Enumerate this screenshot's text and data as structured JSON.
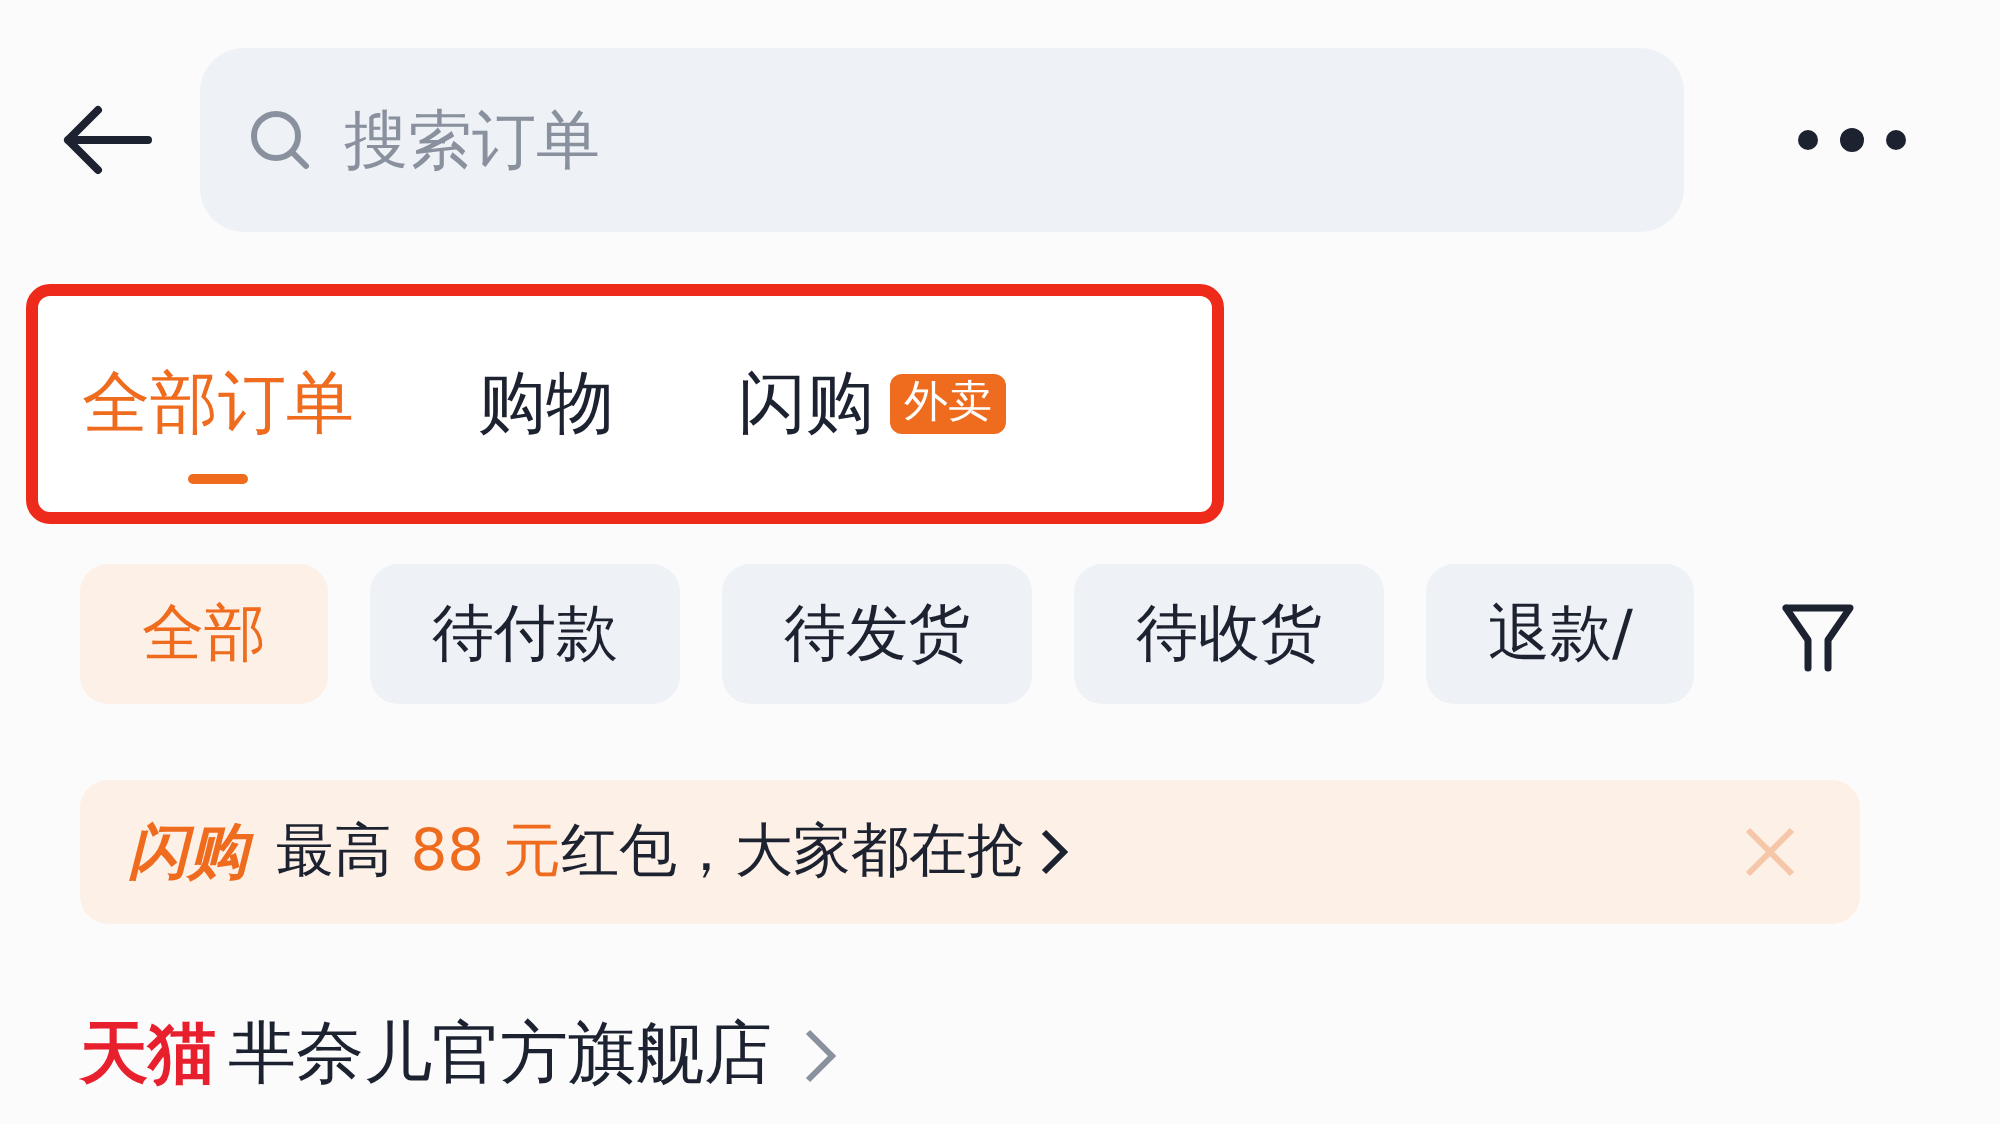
{
  "search": {
    "placeholder": "搜索订单"
  },
  "tabs": [
    {
      "label": "全部订单",
      "selected": true
    },
    {
      "label": "购物",
      "selected": false
    },
    {
      "label": "闪购",
      "selected": false,
      "badge": "外卖"
    }
  ],
  "filters": [
    {
      "label": "全部",
      "selected": true
    },
    {
      "label": "待付款",
      "selected": false
    },
    {
      "label": "待发货",
      "selected": false
    },
    {
      "label": "待收货",
      "selected": false
    },
    {
      "label": "退款/",
      "selected": false
    }
  ],
  "promo": {
    "logo": "闪购",
    "text": "最高 88 元红包，大家都在抢"
  },
  "store": {
    "logo": "天猫",
    "name": "芈奈儿官方旗舰店"
  }
}
